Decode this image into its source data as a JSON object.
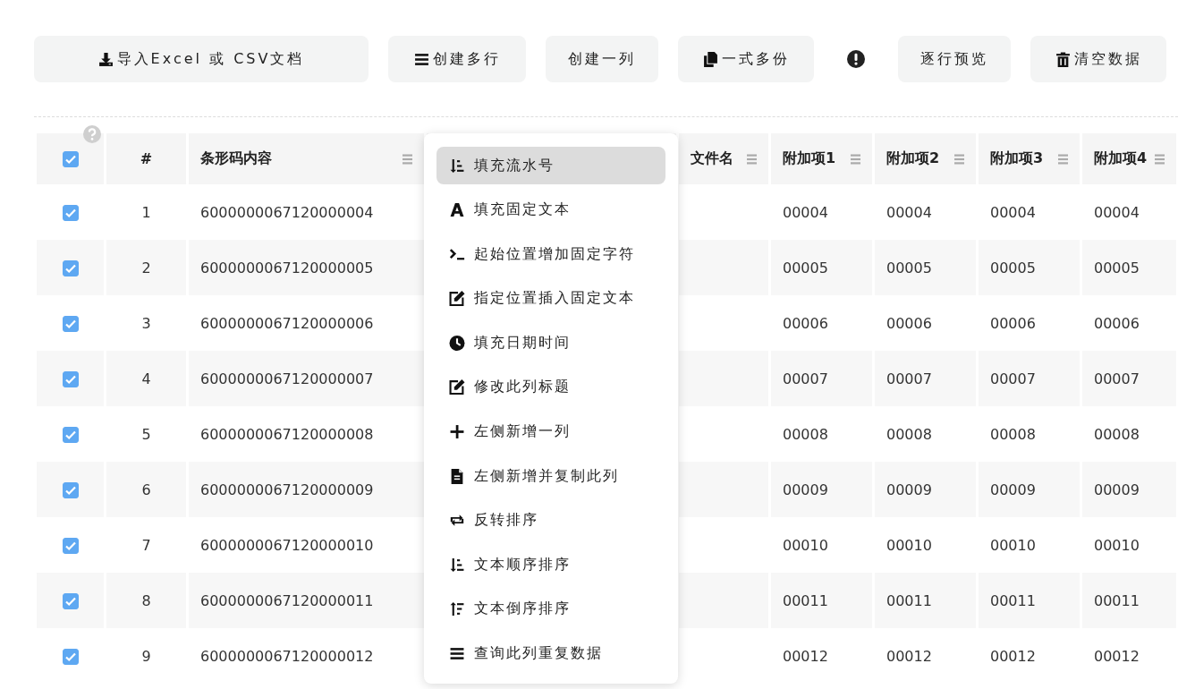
{
  "toolbar": [
    {
      "label": "导入Excel 或 CSV文档"
    },
    {
      "label": "创建多行"
    },
    {
      "label": "创建一列"
    },
    {
      "label": "一式多份"
    },
    {
      "kind": "icon"
    },
    {
      "label": "逐行预览"
    },
    {
      "label": "清空数据"
    }
  ],
  "table": {
    "select_all": {
      "checked": true
    },
    "columns": [
      {
        "label": "#"
      },
      {
        "label": "条形码内容",
        "menu": true
      },
      {
        "menu": false
      },
      {
        "label": "文件名",
        "menu": true
      },
      {
        "label": "附加项1",
        "menu": true
      },
      {
        "label": "附加项2",
        "menu": true
      },
      {
        "label": "附加项3",
        "menu": true
      },
      {
        "label": "附加项4",
        "menu": true
      }
    ],
    "rows": [
      {
        "checked": true,
        "cells": [
          "1",
          "6000000067120000004",
          "",
          "",
          "00004",
          "00004",
          "00004",
          "00004"
        ]
      },
      {
        "checked": true,
        "cells": [
          "2",
          "6000000067120000005",
          "",
          "",
          "00005",
          "00005",
          "00005",
          "00005"
        ]
      },
      {
        "checked": true,
        "cells": [
          "3",
          "6000000067120000006",
          "",
          "",
          "00006",
          "00006",
          "00006",
          "00006"
        ]
      },
      {
        "checked": true,
        "cells": [
          "4",
          "6000000067120000007",
          "",
          "",
          "00007",
          "00007",
          "00007",
          "00007"
        ]
      },
      {
        "checked": true,
        "cells": [
          "5",
          "6000000067120000008",
          "",
          "",
          "00008",
          "00008",
          "00008",
          "00008"
        ]
      },
      {
        "checked": true,
        "cells": [
          "6",
          "6000000067120000009",
          "",
          "",
          "00009",
          "00009",
          "00009",
          "00009"
        ]
      },
      {
        "checked": true,
        "cells": [
          "7",
          "6000000067120000010",
          "",
          "",
          "00010",
          "00010",
          "00010",
          "00010"
        ]
      },
      {
        "checked": true,
        "cells": [
          "8",
          "6000000067120000011",
          "",
          "",
          "00011",
          "00011",
          "00011",
          "00011"
        ]
      },
      {
        "checked": true,
        "cells": [
          "9",
          "6000000067120000012",
          "",
          "",
          "00012",
          "00012",
          "00012",
          "00012"
        ]
      }
    ]
  },
  "column_menu": {
    "items": [
      {
        "label": "填充流水号",
        "selected": true
      },
      {
        "label": "填充固定文本",
        "selected": false
      },
      {
        "label": "起始位置增加固定字符",
        "selected": false
      },
      {
        "label": "指定位置插入固定文本",
        "selected": false
      },
      {
        "label": "填充日期时间",
        "selected": false
      },
      {
        "label": "修改此列标题",
        "selected": false
      },
      {
        "label": "左侧新增一列",
        "selected": false
      },
      {
        "label": "左侧新增并复制此列",
        "selected": false
      },
      {
        "label": "反转排序",
        "selected": false
      },
      {
        "label": "文本顺序排序",
        "selected": false
      },
      {
        "label": "文本倒序排序",
        "selected": false
      },
      {
        "label": "查询此列重复数据",
        "selected": false
      }
    ]
  }
}
